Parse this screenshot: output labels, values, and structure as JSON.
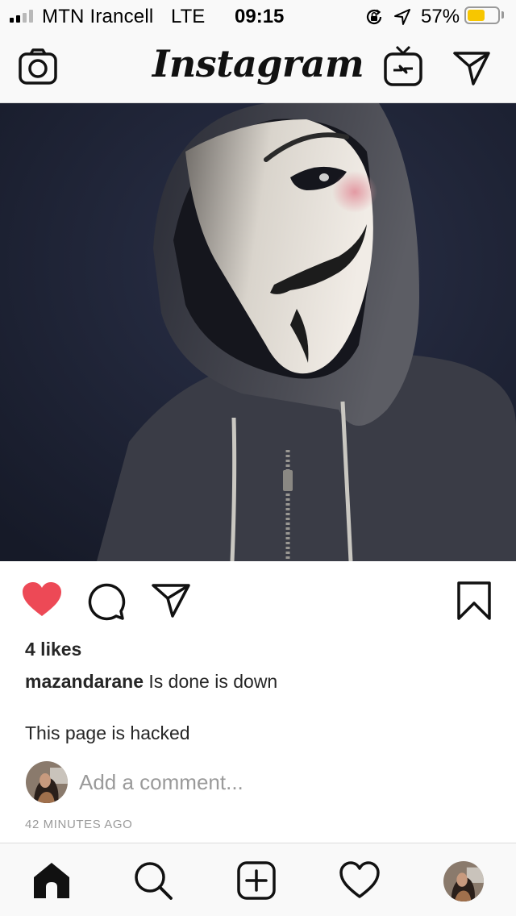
{
  "status_bar": {
    "carrier": "MTN Irancell",
    "network": "LTE",
    "time": "09:15",
    "battery_percent": "57%",
    "battery_level": 0.57,
    "battery_color": "#f7c600",
    "icons": [
      "signal-icon",
      "orientation-lock-icon",
      "location-icon",
      "battery-icon"
    ]
  },
  "header": {
    "logo_text": "Instagram",
    "icons": [
      "camera-icon",
      "igtv-icon",
      "direct-message-icon"
    ]
  },
  "post": {
    "image_subject": "hooded figure wearing a Guy Fawkes mask",
    "liked": true,
    "like_color": "#ed4956",
    "likes": "4 likes",
    "username": "mazandarane",
    "caption": " Is done is down",
    "caption_line2": "This page is hacked",
    "comment_placeholder": "Add a comment...",
    "timestamp": "42 MINUTES AGO",
    "icons": [
      "heart-icon",
      "comment-icon",
      "share-icon",
      "bookmark-icon"
    ]
  },
  "tab_bar": {
    "active_tab": "home",
    "icons": [
      "home-icon",
      "search-icon",
      "new-post-icon",
      "activity-icon",
      "profile-avatar"
    ]
  }
}
